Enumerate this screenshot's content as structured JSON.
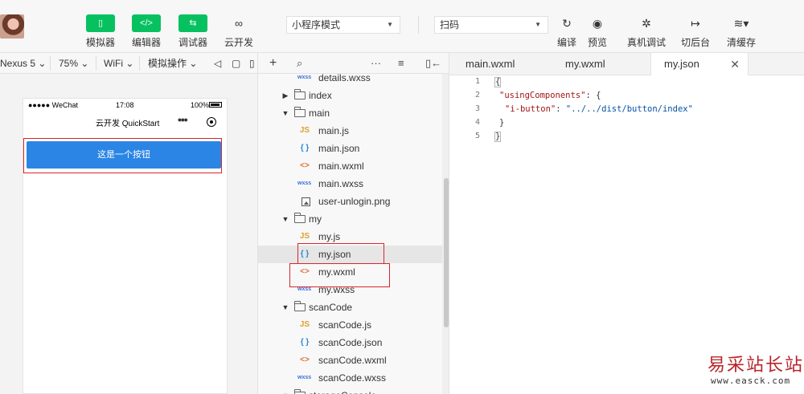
{
  "toolbar": {
    "simulator_label": "模拟器",
    "editor_label": "编辑器",
    "debugger_label": "调试器",
    "cloud_label": "云开发",
    "mode_select": "小程序模式",
    "compile_select": "扫码",
    "compile_label": "编译",
    "preview_label": "预览",
    "remote_debug_label": "真机调试",
    "background_label": "切后台",
    "clear_cache_label": "清缓存",
    "accent_color": "#07c160"
  },
  "simulator": {
    "device": "Nexus 5",
    "zoom": "75%",
    "network": "WiFi",
    "operations": "模拟操作",
    "status": {
      "carrier": "●●●●● WeChat",
      "time": "17:08",
      "battery": "100%"
    },
    "nav_title": "云开发 QuickStart",
    "button_text": "这是一个按钮",
    "button_color": "#2b85e4"
  },
  "file_tree": {
    "rows": [
      {
        "name": "details.wxss",
        "type": "wxss"
      },
      {
        "name": "index",
        "type": "folder"
      },
      {
        "name": "main",
        "type": "folder"
      },
      {
        "name": "main.js",
        "type": "js"
      },
      {
        "name": "main.json",
        "type": "json"
      },
      {
        "name": "main.wxml",
        "type": "wxml"
      },
      {
        "name": "main.wxss",
        "type": "wxss"
      },
      {
        "name": "user-unlogin.png",
        "type": "image"
      },
      {
        "name": "my",
        "type": "folder"
      },
      {
        "name": "my.js",
        "type": "js"
      },
      {
        "name": "my.json",
        "type": "json"
      },
      {
        "name": "my.wxml",
        "type": "wxml"
      },
      {
        "name": "my.wxss",
        "type": "wxss"
      },
      {
        "name": "scanCode",
        "type": "folder"
      },
      {
        "name": "scanCode.js",
        "type": "js"
      },
      {
        "name": "scanCode.json",
        "type": "json"
      },
      {
        "name": "scanCode.wxml",
        "type": "wxml"
      },
      {
        "name": "scanCode.wxss",
        "type": "wxss"
      },
      {
        "name": "storageConsole",
        "type": "folder"
      }
    ],
    "icons": {
      "js": "JS",
      "json": "{ }",
      "wxml": "<>",
      "wxss": "wxss"
    }
  },
  "editor": {
    "tabs": [
      "main.wxml",
      "my.wxml",
      "my.json"
    ],
    "active_tab": "my.json",
    "line_numbers": [
      "1",
      "2",
      "3",
      "4",
      "5"
    ],
    "code": {
      "open_brace": "{",
      "key1": "\"usingComponents\"",
      "colon_brace": ": {",
      "key2": "\"i-button\"",
      "colon": ": ",
      "value2": "\"../../dist/button/index\"",
      "close_inner": "}",
      "close_outer": "}"
    }
  },
  "watermark": {
    "site": "易采站长站",
    "url": "www.easck.com"
  }
}
